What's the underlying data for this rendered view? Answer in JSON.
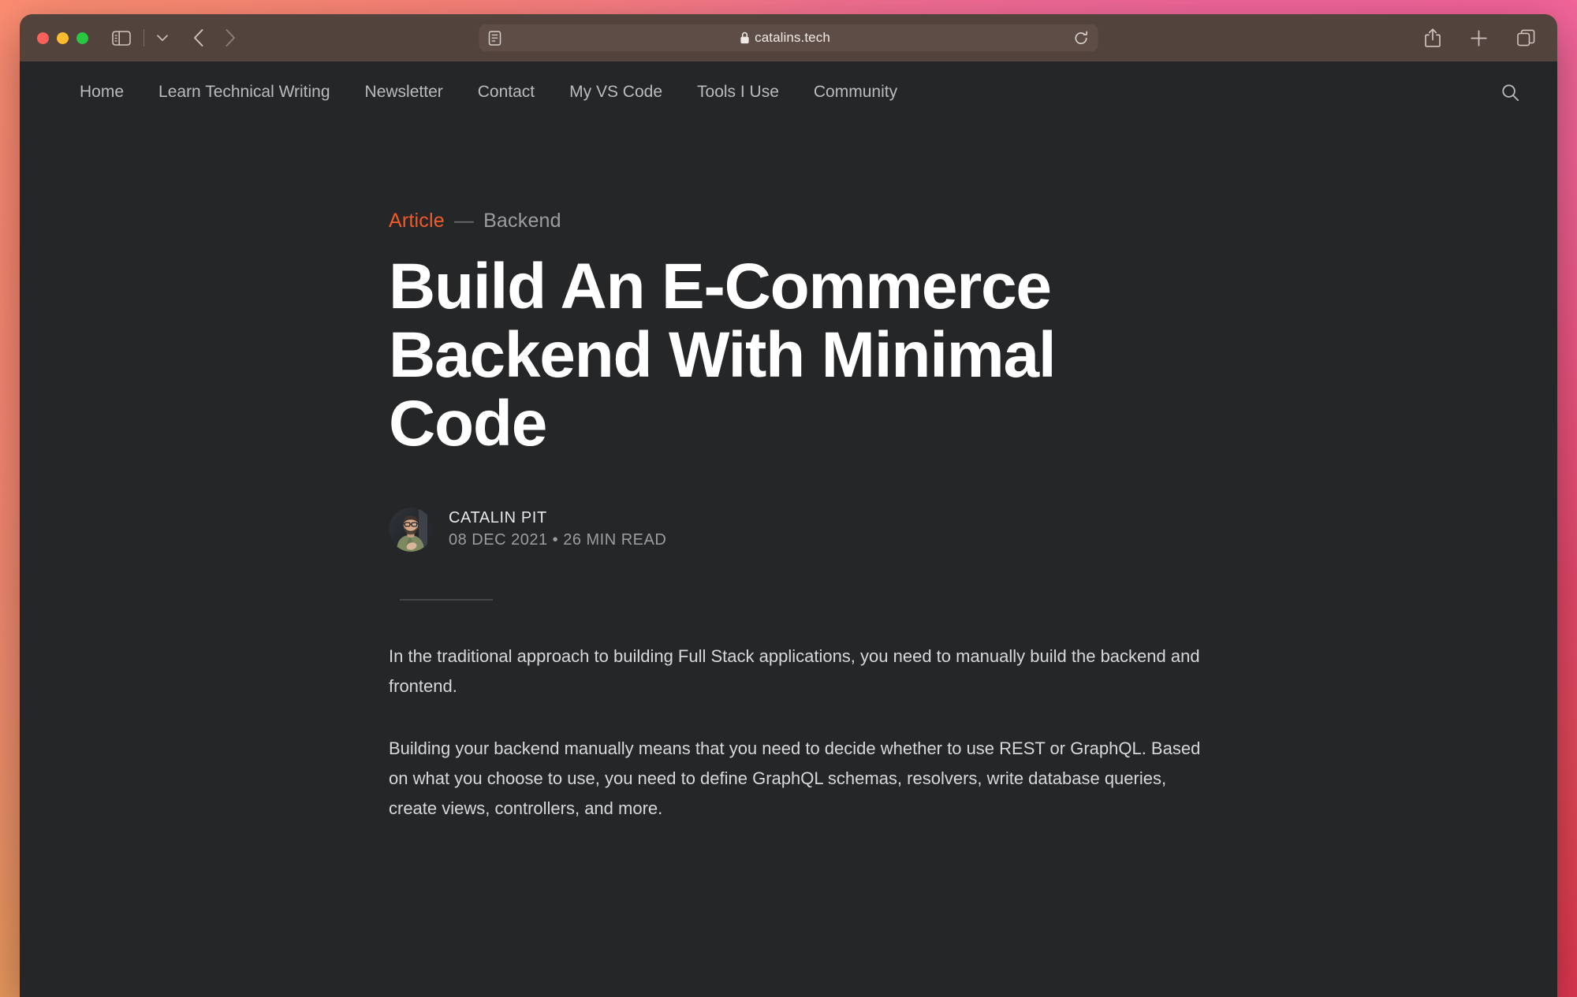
{
  "browser": {
    "traffic_lights": [
      {
        "name": "close",
        "color": "#ff6058"
      },
      {
        "name": "minimize",
        "color": "#ffbd2e"
      },
      {
        "name": "zoom",
        "color": "#28c840"
      }
    ],
    "sidebar_button_label": "Sidebar",
    "sidebar_dropdown_label": "Sidebar options",
    "back_label": "Back",
    "forward_label": "Forward",
    "url": {
      "text": "catalins.tech",
      "reader_label": "Reader view",
      "lock_label": "Secure connection",
      "reload_label": "Reload this page"
    },
    "actions": [
      {
        "name": "share-icon",
        "label": "Share"
      },
      {
        "name": "new-tab-icon",
        "label": "New Tab"
      },
      {
        "name": "tab-overview-icon",
        "label": "Tab Overview"
      }
    ]
  },
  "site": {
    "nav": [
      {
        "label": "Home"
      },
      {
        "label": "Learn Technical Writing"
      },
      {
        "label": "Newsletter"
      },
      {
        "label": "Contact"
      },
      {
        "label": "My VS Code"
      },
      {
        "label": "Tools I Use"
      },
      {
        "label": "Community"
      }
    ],
    "search_label": "Search"
  },
  "article": {
    "kicker": {
      "primary": "Article",
      "dash": "—",
      "secondary": "Backend"
    },
    "headline": "Build An E-Commerce Backend With Minimal Code",
    "byline": {
      "author": "CATALIN PIT",
      "meta": "08 DEC 2021 • 26 MIN READ",
      "avatar_label": "Author avatar"
    },
    "paragraphs": [
      "In the traditional approach to building Full Stack applications, you need to manually build the backend and frontend.",
      "Building your backend manually means that you need to decide whether to use REST or GraphQL. Based on what you choose to use, you need to define GraphQL schemas, resolvers, write database queries, create views, controllers, and more."
    ]
  },
  "colors": {
    "accent": "#f15a29",
    "page_bg": "#242628",
    "toolbar_bg": "#53433d",
    "desktop_gradient_top_left": "#fc8d72",
    "desktop_gradient_top_right": "#f26599",
    "desktop_gradient_bottom_left": "#e99b5a",
    "desktop_gradient_bottom_right": "#e03050"
  }
}
